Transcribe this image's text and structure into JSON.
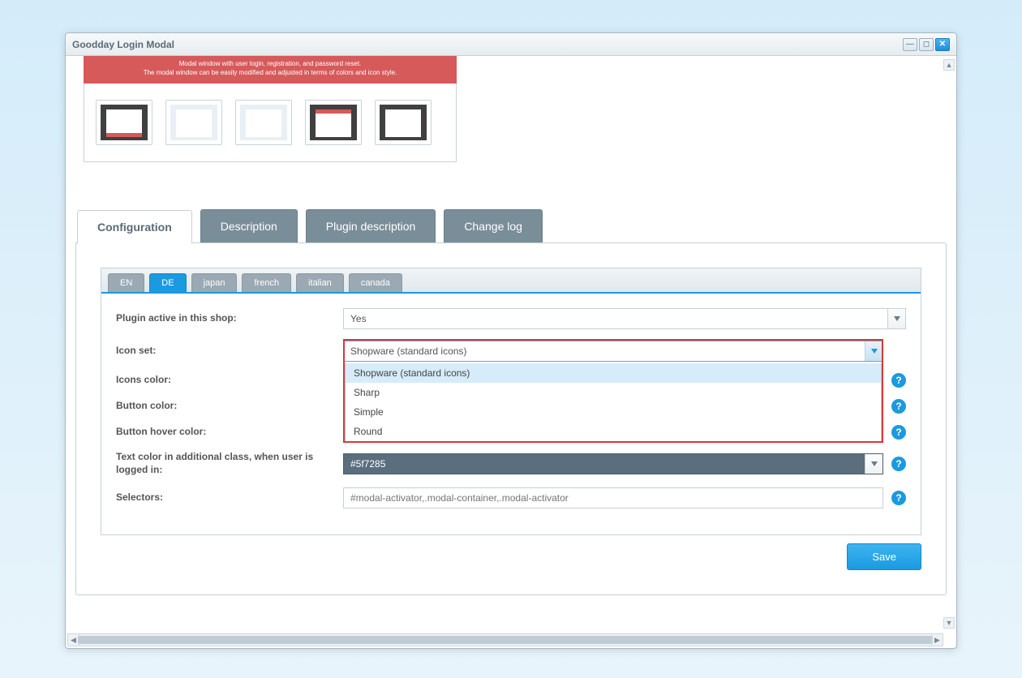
{
  "window": {
    "title": "Goodday Login Modal"
  },
  "hero": {
    "line1": "Modal window with user login, registration, and password reset.",
    "line2": "The modal window can be easily modified and adjusted in terms of colors and icon style."
  },
  "tabs": [
    {
      "label": "Configuration",
      "active": true
    },
    {
      "label": "Description",
      "active": false
    },
    {
      "label": "Plugin description",
      "active": false
    },
    {
      "label": "Change log",
      "active": false
    }
  ],
  "lang_tabs": [
    {
      "label": "EN",
      "active": false
    },
    {
      "label": "DE",
      "active": true
    },
    {
      "label": "japan",
      "active": false
    },
    {
      "label": "french",
      "active": false
    },
    {
      "label": "italian",
      "active": false
    },
    {
      "label": "canada",
      "active": false
    }
  ],
  "form": {
    "plugin_active": {
      "label": "Plugin active in this shop:",
      "value": "Yes"
    },
    "icon_set": {
      "label": "Icon set:",
      "value": "Shopware (standard icons)",
      "options": [
        "Shopware (standard icons)",
        "Sharp",
        "Simple",
        "Round"
      ]
    },
    "icons_color": {
      "label": "Icons color:"
    },
    "button_color": {
      "label": "Button color:"
    },
    "button_hover_color": {
      "label": "Button hover color:"
    },
    "text_color_logged": {
      "label": "Text color in additional class, when user is logged in:",
      "value": "#5f7285"
    },
    "selectors": {
      "label": "Selectors:",
      "placeholder": "#modal-activator,.modal-container,.modal-activator"
    }
  },
  "save_label": "Save"
}
